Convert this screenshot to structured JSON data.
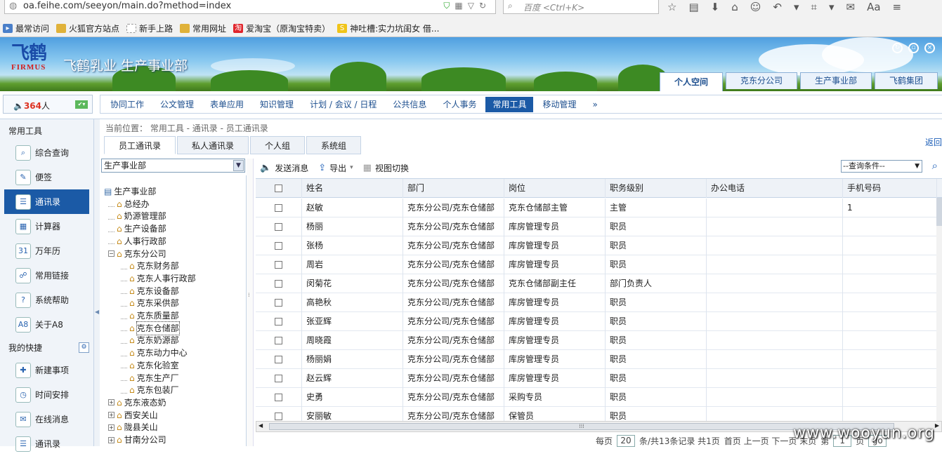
{
  "browser": {
    "url": "oa.feihe.com/seeyon/main.do?method=index",
    "search_placeholder": "百度 <Ctrl+K>",
    "bookmarks": [
      {
        "label": "最常访问",
        "icon": "bookmark-icon",
        "color": "#4a7fc9"
      },
      {
        "label": "火狐官方站点",
        "icon": "folder-icon",
        "color": "#e0b23a"
      },
      {
        "label": "新手上路",
        "icon": "page-icon",
        "color": "#999999"
      },
      {
        "label": "常用网址",
        "icon": "folder-icon",
        "color": "#e0b23a"
      },
      {
        "label": "爱淘宝（原淘宝特卖）",
        "icon": "taobao-icon",
        "color": "#e0242b"
      },
      {
        "label": "神吐槽:实力坑闺女 借...",
        "icon": "s-icon",
        "color": "#f0c419"
      }
    ]
  },
  "header": {
    "logo_cn": "飞鹤",
    "logo_en": "FIRMUS",
    "title": "飞鹤乳业  生产事业部",
    "tabs": [
      "个人空间",
      "克东分公司",
      "生产事业部",
      "飞鹤集团"
    ],
    "active_tab": 0
  },
  "online": {
    "count": "364",
    "suffix": "人"
  },
  "mainnav": {
    "items": [
      "协同工作",
      "公文管理",
      "表单应用",
      "知识管理",
      "计划 / 会议 / 日程",
      "公共信息",
      "个人事务",
      "常用工具",
      "移动管理"
    ],
    "active": 7,
    "more": "»"
  },
  "sidebar": {
    "header": "常用工具",
    "items": [
      {
        "label": "综合查询",
        "icon": "search-icon"
      },
      {
        "label": "便签",
        "icon": "note-icon"
      },
      {
        "label": "通讯录",
        "icon": "addressbook-icon"
      },
      {
        "label": "计算器",
        "icon": "calculator-icon"
      },
      {
        "label": "万年历",
        "icon": "calendar-icon"
      },
      {
        "label": "常用链接",
        "icon": "link-icon"
      },
      {
        "label": "系统帮助",
        "icon": "help-icon"
      },
      {
        "label": "关于A8",
        "icon": "about-icon"
      }
    ],
    "active": 2,
    "header2": "我的快捷",
    "quick": [
      {
        "label": "新建事项",
        "icon": "new-item-icon"
      },
      {
        "label": "时间安排",
        "icon": "schedule-icon"
      },
      {
        "label": "在线消息",
        "icon": "message-icon"
      },
      {
        "label": "通讯录",
        "icon": "addressbook-icon"
      }
    ]
  },
  "content": {
    "breadcrumb": "当前位置： 常用工具 - 通讯录 - 员工通讯录",
    "return": "返回",
    "subtabs": [
      "员工通讯录",
      "私人通讯录",
      "个人组",
      "系统组"
    ],
    "active_subtab": 0,
    "dept_select": "生产事业部",
    "toolbar": {
      "send": "发送消息",
      "export": "导出",
      "switch": "视图切换"
    },
    "query_select": "--查询条件--"
  },
  "tree": [
    {
      "label": "生产事业部",
      "level": 0,
      "toggle": "",
      "type": "root"
    },
    {
      "label": "总经办",
      "level": 1,
      "toggle": ""
    },
    {
      "label": "奶源管理部",
      "level": 1,
      "toggle": ""
    },
    {
      "label": "生产设备部",
      "level": 1,
      "toggle": ""
    },
    {
      "label": "人事行政部",
      "level": 1,
      "toggle": ""
    },
    {
      "label": "克东分公司",
      "level": 1,
      "toggle": "−"
    },
    {
      "label": "克东财务部",
      "level": 2,
      "toggle": ""
    },
    {
      "label": "克东人事行政部",
      "level": 2,
      "toggle": ""
    },
    {
      "label": "克东设备部",
      "level": 2,
      "toggle": ""
    },
    {
      "label": "克东采供部",
      "level": 2,
      "toggle": ""
    },
    {
      "label": "克东质量部",
      "level": 2,
      "toggle": ""
    },
    {
      "label": "克东仓储部",
      "level": 2,
      "toggle": "",
      "selected": true
    },
    {
      "label": "克东奶源部",
      "level": 2,
      "toggle": ""
    },
    {
      "label": "克东动力中心",
      "level": 2,
      "toggle": ""
    },
    {
      "label": "克东化验室",
      "level": 2,
      "toggle": ""
    },
    {
      "label": "克东生产厂",
      "level": 2,
      "toggle": ""
    },
    {
      "label": "克东包装厂",
      "level": 2,
      "toggle": ""
    },
    {
      "label": "克东液态奶",
      "level": 1,
      "toggle": "+"
    },
    {
      "label": "西安关山",
      "level": 1,
      "toggle": "+"
    },
    {
      "label": "陇县关山",
      "level": 1,
      "toggle": "+"
    },
    {
      "label": "甘南分公司",
      "level": 1,
      "toggle": "+"
    }
  ],
  "table": {
    "columns": [
      "",
      "姓名",
      "部门",
      "岗位",
      "职务级别",
      "办公电话",
      "手机号码"
    ],
    "rows": [
      [
        "赵敏",
        "克东分公司/克东仓储部",
        "克东仓储部主管",
        "主管",
        "",
        "1"
      ],
      [
        "杨丽",
        "克东分公司/克东仓储部",
        "库房管理专员",
        "职员",
        "",
        ""
      ],
      [
        "张杨",
        "克东分公司/克东仓储部",
        "库房管理专员",
        "职员",
        "",
        ""
      ],
      [
        "周岩",
        "克东分公司/克东仓储部",
        "库房管理专员",
        "职员",
        "",
        ""
      ],
      [
        "闵菊花",
        "克东分公司/克东仓储部",
        "克东仓储部副主任",
        "部门负责人",
        "",
        ""
      ],
      [
        "高艳秋",
        "克东分公司/克东仓储部",
        "库房管理专员",
        "职员",
        "",
        ""
      ],
      [
        "张亚辉",
        "克东分公司/克东仓储部",
        "库房管理专员",
        "职员",
        "",
        ""
      ],
      [
        "周晓霞",
        "克东分公司/克东仓储部",
        "库房管理专员",
        "职员",
        "",
        ""
      ],
      [
        "杨丽娟",
        "克东分公司/克东仓储部",
        "库房管理专员",
        "职员",
        "",
        ""
      ],
      [
        "赵云辉",
        "克东分公司/克东仓储部",
        "库房管理专员",
        "职员",
        "",
        ""
      ],
      [
        "史勇",
        "克东分公司/克东仓储部",
        "采购专员",
        "职员",
        "",
        ""
      ],
      [
        "安丽敏",
        "克东分公司/克东仓储部",
        "保管员",
        "职员",
        "",
        ""
      ]
    ]
  },
  "pager": {
    "per_page_label": "每页",
    "per_page": "20",
    "summary": "条/共13条记录  共1页",
    "nav": "首页  上一页  下一页  末页",
    "page_label": "第",
    "page": "1",
    "page_suffix": "页",
    "go": "go"
  },
  "watermark": "www.wooyun.org"
}
